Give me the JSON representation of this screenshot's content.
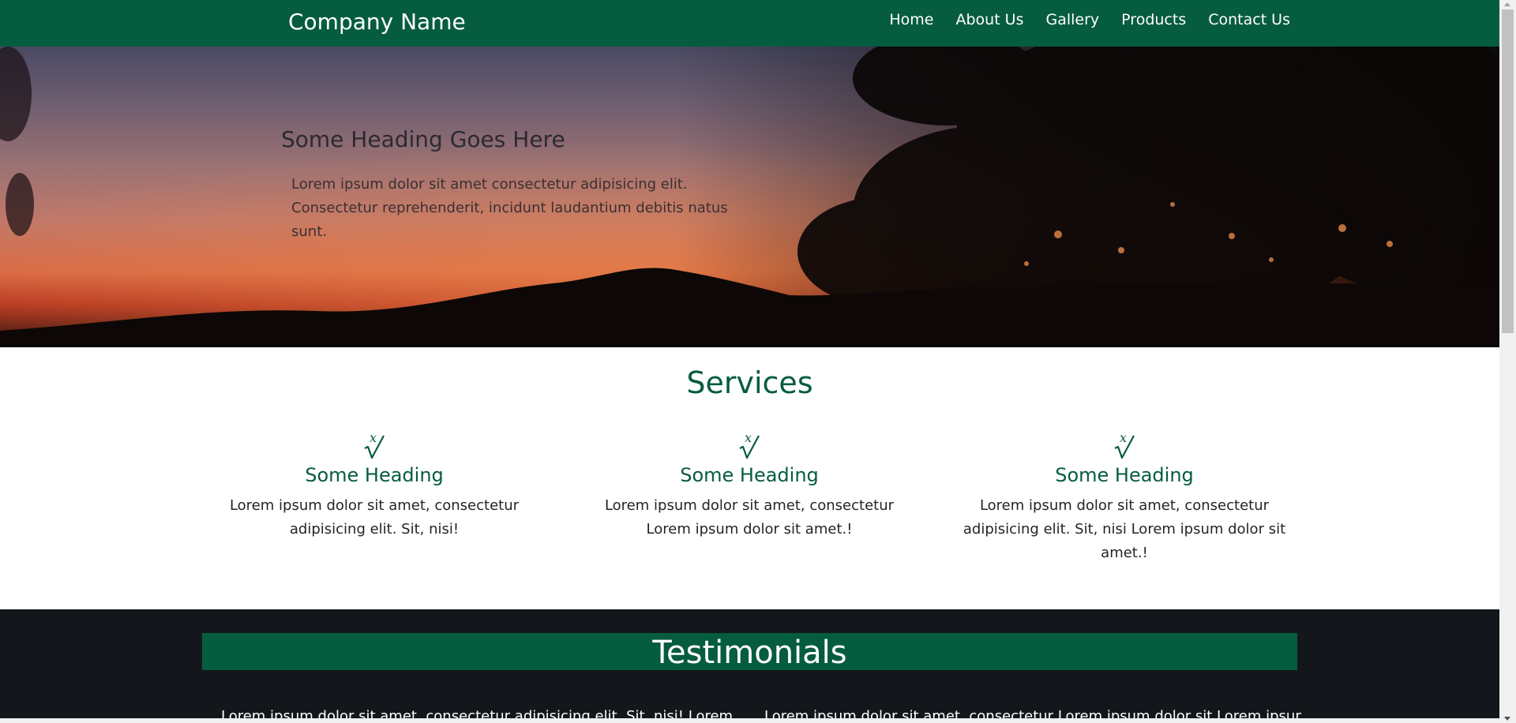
{
  "navbar": {
    "brand": "Company Name",
    "items": [
      {
        "label": "Home"
      },
      {
        "label": "About Us"
      },
      {
        "label": "Gallery"
      },
      {
        "label": "Products"
      },
      {
        "label": "Contact Us"
      }
    ],
    "background_color": "#065c3f"
  },
  "hero": {
    "heading": "Some Heading Goes Here",
    "text": "Lorem ipsum dolor sit amet consectetur adipisicing elit. Consectetur reprehenderit, incidunt laudantium debitis natus sunt."
  },
  "services": {
    "title": "Services",
    "icon": "square-root-x-icon",
    "items": [
      {
        "heading": "Some Heading",
        "text": "Lorem ipsum dolor sit amet, consectetur adipisicing elit. Sit, nisi!"
      },
      {
        "heading": "Some Heading",
        "text": "Lorem ipsum dolor sit amet, consectetur Lorem ipsum dolor sit amet.!"
      },
      {
        "heading": "Some Heading",
        "text": "Lorem ipsum dolor sit amet, consectetur adipisicing elit. Sit, nisi Lorem ipsum dolor sit amet.!"
      }
    ],
    "accent_color": "#065c3f"
  },
  "testimonials": {
    "title": "Testimonials",
    "items": [
      {
        "text": "Lorem ipsum dolor sit amet, consectetur adipisicing elit. Sit, nisi! Lorem"
      },
      {
        "text": "Lorem ipsum dolor sit amet, consectetur Lorem ipsum dolor sit Lorem ipsum"
      }
    ],
    "background_color": "#13171b"
  }
}
